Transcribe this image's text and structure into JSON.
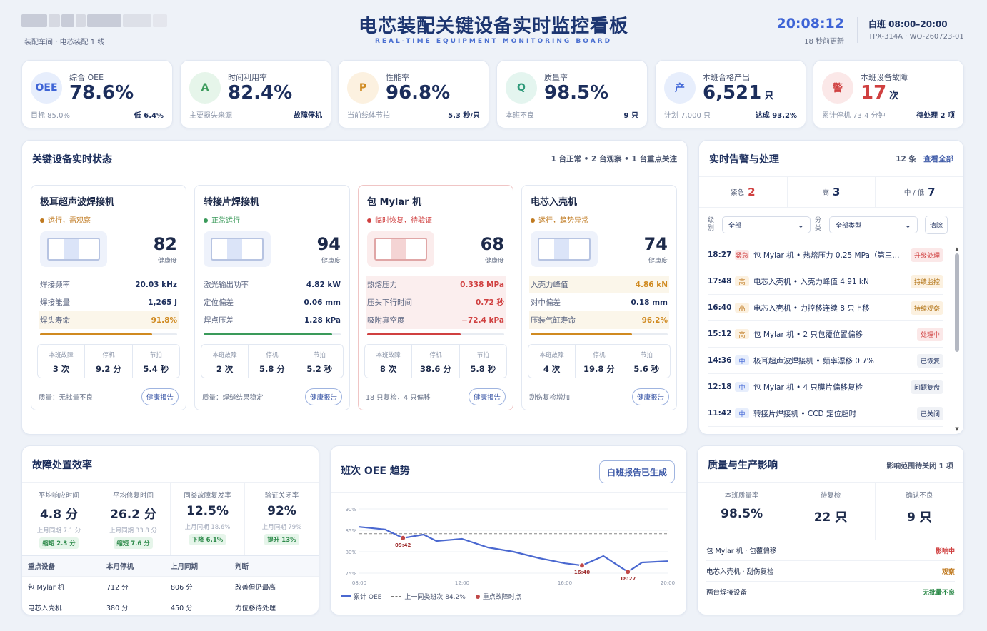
{
  "header": {
    "title": "电芯装配关键设备实时监控看板",
    "subtitle": "REAL-TIME EQUIPMENT MONITORING BOARD",
    "location": "装配车间 · 电芯装配 1 线",
    "time": "20:08:12",
    "updated": "18 秒前更新",
    "shift": "白班 08:00–20:00",
    "order": "TPX-314A · WO-260723-01"
  },
  "kpis": [
    {
      "badge": "OEE",
      "label": "综合 OEE",
      "value": "78.6%",
      "unit": "",
      "foot_left": "目标 85.0%",
      "foot_right": "低 6.4%",
      "color": "#3e64d6",
      "bg": "#e7eefc"
    },
    {
      "badge": "A",
      "label": "时间利用率",
      "value": "82.4%",
      "unit": "",
      "foot_left": "主要损失来源",
      "foot_right": "故障停机",
      "color": "#3a9a5a",
      "bg": "#e6f5ea"
    },
    {
      "badge": "P",
      "label": "性能率",
      "value": "96.8%",
      "unit": "",
      "foot_left": "当前线体节拍",
      "foot_right": "5.3 秒/只",
      "color": "#d08a20",
      "bg": "#fcf1e0"
    },
    {
      "badge": "Q",
      "label": "质量率",
      "value": "98.5%",
      "unit": "",
      "foot_left": "本班不良",
      "foot_right": "9 只",
      "color": "#2f9a7a",
      "bg": "#e4f5ef"
    },
    {
      "badge": "产",
      "label": "本班合格产出",
      "value": "6,521",
      "unit": "只",
      "foot_left": "计划 7,000 只",
      "foot_right": "达成 93.2%",
      "color": "#3e64d6",
      "bg": "#e7eefc"
    },
    {
      "badge": "警",
      "label": "本班设备故障",
      "value": "17",
      "unit": "次",
      "foot_left": "累计停机 73.4 分钟",
      "foot_right": "待处理 2 项",
      "color": "#d04040",
      "bg": "#fbe8e8"
    }
  ],
  "devices_panel": {
    "title": "关键设备实时状态",
    "summary": "1 台正常 • 2 台观察 • 1 台重点关注"
  },
  "devices": [
    {
      "name": "极耳超声波焊接机",
      "status": "运行，需观察",
      "status_color": "#c07a20",
      "score": "82",
      "score_label": "健康度",
      "rows": [
        [
          "焊接频率",
          "20.03 kHz",
          ""
        ],
        [
          "焊接能量",
          "1,265 J",
          ""
        ],
        [
          "焊头寿命",
          "91.8%",
          "warn"
        ]
      ],
      "bar": 0.82,
      "bar_color": "#d08a20",
      "stats": [
        [
          "本班故障",
          "3 次"
        ],
        [
          "停机",
          "9.2 分"
        ],
        [
          "节拍",
          "5.4 秒"
        ]
      ],
      "foot": "质量：无批量不良",
      "btn": "健康报告",
      "alert": false
    },
    {
      "name": "转接片焊接机",
      "status": "正常运行",
      "status_color": "#3a9a5a",
      "score": "94",
      "score_label": "健康度",
      "rows": [
        [
          "激光输出功率",
          "4.82 kW",
          ""
        ],
        [
          "定位偏差",
          "0.06 mm",
          ""
        ],
        [
          "焊点压差",
          "1.28 kPa",
          ""
        ]
      ],
      "bar": 0.94,
      "bar_color": "#3a9a5a",
      "stats": [
        [
          "本班故障",
          "2 次"
        ],
        [
          "停机",
          "5.8 分"
        ],
        [
          "节拍",
          "5.2 秒"
        ]
      ],
      "foot": "质量：焊缝结果稳定",
      "btn": "健康报告",
      "alert": false
    },
    {
      "name": "包 Mylar 机",
      "status": "临时恢复，待验证",
      "status_color": "#d04040",
      "score": "68",
      "score_label": "健康度",
      "rows": [
        [
          "热熔压力",
          "0.338 MPa",
          "bad"
        ],
        [
          "压头下行时间",
          "0.72 秒",
          "bad"
        ],
        [
          "吸附真空度",
          "−72.4 kPa",
          "bad"
        ]
      ],
      "bar": 0.68,
      "bar_color": "#d04040",
      "stats": [
        [
          "本班故障",
          "8 次"
        ],
        [
          "停机",
          "38.6 分"
        ],
        [
          "节拍",
          "5.8 秒"
        ]
      ],
      "foot": "18 只复检，4 只偏移",
      "btn": "健康报告",
      "alert": true
    },
    {
      "name": "电芯入壳机",
      "status": "运行，趋势异常",
      "status_color": "#c07a20",
      "score": "74",
      "score_label": "健康度",
      "rows": [
        [
          "入壳力峰值",
          "4.86 kN",
          "warn"
        ],
        [
          "对中偏差",
          "0.18 mm",
          ""
        ],
        [
          "压装气缸寿命",
          "96.2%",
          "warn"
        ]
      ],
      "bar": 0.74,
      "bar_color": "#d08a20",
      "stats": [
        [
          "本班故障",
          "4 次"
        ],
        [
          "停机",
          "19.8 分"
        ],
        [
          "节拍",
          "5.6 秒"
        ]
      ],
      "foot": "刮伤复检增加",
      "btn": "健康报告",
      "alert": false
    }
  ],
  "alarms": {
    "title": "实时告警与处理",
    "count": "12 条",
    "view_all": "查看全部",
    "levels": [
      [
        "紧急",
        "2",
        "#d04040"
      ],
      [
        "高",
        "3",
        "#1c2e5c"
      ],
      [
        "中 / 低",
        "7",
        "#1c2e5c"
      ]
    ],
    "filter_level_label": "级别",
    "filter_level_value": "全部",
    "filter_type_label": "分类",
    "filter_type_value": "全部类型",
    "clear": "清除",
    "items": [
      {
        "time": "18:27",
        "level": "紧急",
        "lv_color": "#d04040",
        "lv_bg": "#fbe8e8",
        "text": "包 Mylar 机 • 热熔压力 0.25 MPa（第三...",
        "status": "升级处理",
        "st_color": "#d04040",
        "st_bg": "#fbe8e8"
      },
      {
        "time": "17:48",
        "level": "高",
        "lv_color": "#c07a20",
        "lv_bg": "#fcf1e0",
        "text": "电芯入壳机 • 入壳力峰值 4.91 kN",
        "status": "持续监控",
        "st_color": "#b07010",
        "st_bg": "#fcf1e0"
      },
      {
        "time": "16:40",
        "level": "高",
        "lv_color": "#c07a20",
        "lv_bg": "#fcf1e0",
        "text": "电芯入壳机 • 力控移连续 8 只上移",
        "status": "持续观察",
        "st_color": "#b07010",
        "st_bg": "#fcf1e0"
      },
      {
        "time": "15:12",
        "level": "高",
        "lv_color": "#c07a20",
        "lv_bg": "#fcf1e0",
        "text": "包 Mylar 机 • 2 只包覆位置偏移",
        "status": "处理中",
        "st_color": "#d04040",
        "st_bg": "#fbe8e8"
      },
      {
        "time": "14:36",
        "level": "中",
        "lv_color": "#3e64d6",
        "lv_bg": "#e7eefc",
        "text": "极耳超声波焊接机 • 频率漂移 0.7%",
        "status": "已恢复",
        "st_color": "#1c2e5c",
        "st_bg": "#f0f2f6"
      },
      {
        "time": "12:18",
        "level": "中",
        "lv_color": "#3e64d6",
        "lv_bg": "#e7eefc",
        "text": "包 Mylar 机 • 4 只膜片偏移复检",
        "status": "问题复盘",
        "st_color": "#1c2e5c",
        "st_bg": "#f0f2f6"
      },
      {
        "time": "11:42",
        "level": "中",
        "lv_color": "#3e64d6",
        "lv_bg": "#e7eefc",
        "text": "转接片焊接机 • CCD 定位超时",
        "status": "已关闭",
        "st_color": "#1c2e5c",
        "st_bg": "#f0f2f6"
      }
    ]
  },
  "fault": {
    "title": "故障处置效率",
    "metrics": [
      {
        "label": "平均响应时间",
        "value": "4.8 分",
        "prev": "上月同期 7.1 分",
        "chg": "缩短 2.3 分"
      },
      {
        "label": "平均修复时间",
        "value": "26.2 分",
        "prev": "上月同期 33.8 分",
        "chg": "缩短 7.6 分"
      },
      {
        "label": "同类故障复发率",
        "value": "12.5%",
        "prev": "上月同期 18.6%",
        "chg": "下降 6.1%"
      },
      {
        "label": "验证关闭率",
        "value": "92%",
        "prev": "上月同期 79%",
        "chg": "提升 13%"
      }
    ],
    "table_head": [
      "重点设备",
      "本月停机",
      "上月同期",
      "判断"
    ],
    "table_rows": [
      [
        "包 Mylar 机",
        "712 分",
        "806 分",
        "改善但仍最高"
      ],
      [
        "电芯入壳机",
        "380 分",
        "450 分",
        "力位移待处理"
      ]
    ]
  },
  "oee_trend": {
    "title": "班次 OEE 趋势",
    "button": "白班报告已生成",
    "legend": [
      "累计 OEE",
      "上一同类班次 84.2%",
      "重点故障时点"
    ]
  },
  "chart_data": {
    "type": "line",
    "x": [
      "08:00",
      "09:00",
      "09:42",
      "10:30",
      "11:00",
      "12:00",
      "13:00",
      "14:00",
      "15:00",
      "16:00",
      "16:40",
      "17:30",
      "18:27",
      "19:00",
      "20:00"
    ],
    "series": [
      {
        "name": "累计 OEE",
        "values": [
          85.8,
          85.2,
          83.2,
          84.0,
          82.5,
          83.0,
          81.0,
          80.0,
          78.5,
          77.3,
          76.8,
          79.0,
          75.3,
          77.5,
          77.8
        ]
      }
    ],
    "baseline": 84.2,
    "markers": [
      {
        "x": "09:42",
        "label": "09:42"
      },
      {
        "x": "16:40",
        "label": "16:40"
      },
      {
        "x": "18:27",
        "label": "18:27"
      }
    ],
    "yticks": [
      "90%",
      "85%",
      "80%",
      "75%"
    ],
    "xticks": [
      "08:00",
      "12:00",
      "16:00",
      "20:00"
    ],
    "ylim": [
      75,
      90
    ],
    "grid": true
  },
  "quality": {
    "title": "质量与生产影响",
    "scope": "影响范围待关闭 1 项",
    "metrics": [
      [
        "本班质量率",
        "98.5%"
      ],
      [
        "待复检",
        "22 只"
      ],
      [
        "确认不良",
        "9 只"
      ]
    ],
    "rows": [
      {
        "label": "包 Mylar 机 · 包覆偏移",
        "status": "影响中",
        "color": "#d04040"
      },
      {
        "label": "电芯入壳机 · 刮伤复检",
        "status": "观察",
        "color": "#c07a20"
      },
      {
        "label": "两台焊接设备",
        "status": "无批量不良",
        "color": "#2d8a4a"
      }
    ]
  }
}
